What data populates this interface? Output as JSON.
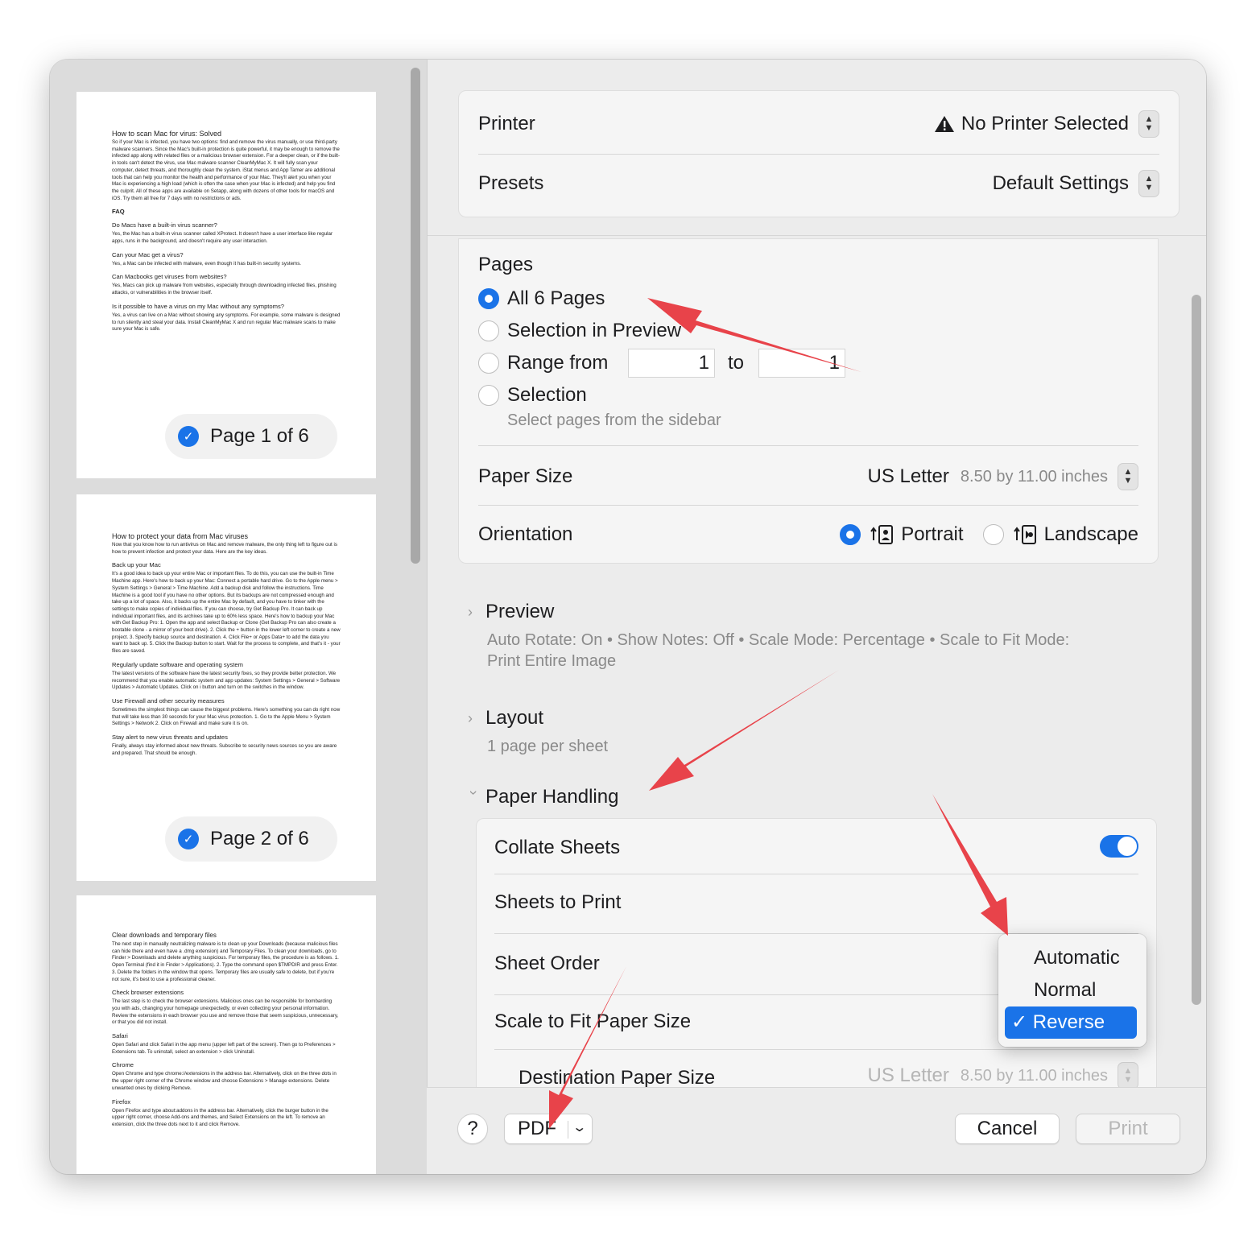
{
  "colors": {
    "accent": "#1a73e8",
    "arrow": "#e8434a"
  },
  "sidebar": {
    "pages": [
      {
        "badge": "Page 1 of 6",
        "title": "How to scan Mac for virus: Solved",
        "intro": "So if your Mac is infected, you have two options: find and remove the virus manually, or use third-party malware scanners. Since the Mac's built-in protection is quite powerful, it may be enough to remove the infected app along with related files or a malicious browser extension. For a deeper clean, or if the built-in tools can't detect the virus, use Mac malware scanner CleanMyMac X. It will fully scan your computer, detect threats, and thoroughly clean the system. iStat menus and App Tamer are additional tools that can help you monitor the health and performance of your Mac. They'll alert you when your Mac is experiencing a high load (which is often the case when your Mac is infected) and help you find the culprit. All of these apps are available on Setapp, along with dozens of other tools for macOS and iOS. Try them all free for 7 days with no restrictions or ads.",
        "faq": "FAQ",
        "q1": "Do Macs have a built-in virus scanner?",
        "a1": "Yes, the Mac has a built-in virus scanner called XProtect. It doesn't have a user interface like regular apps, runs in the background, and doesn't require any user interaction.",
        "q2": "Can your Mac get a virus?",
        "a2": "Yes, a Mac can be infected with malware, even though it has built-in security systems.",
        "q3": "Can Macbooks get viruses from websites?",
        "a3": "Yes, Macs can pick up malware from websites, especially through downloading infected files, phishing attacks, or vulnerabilities in the browser itself.",
        "q4": "Is it possible to have a virus on my Mac without any symptoms?",
        "a4": "Yes, a virus can live on a Mac without showing any symptoms. For example, some malware is designed to run silently and steal your data. Install CleanMyMac X and run regular Mac malware scans to make sure your Mac is safe."
      },
      {
        "badge": "Page 2 of 6",
        "title": "How to protect your data from Mac viruses",
        "intro": "Now that you know how to run antivirus on Mac and remove malware, the only thing left to figure out is how to prevent infection and protect your data. Here are the key ideas.",
        "q1": "Back up your Mac",
        "a1": "It's a good idea to back up your entire Mac or important files. To do this, you can use the built-in Time Machine app. Here's how to back up your Mac: Connect a portable hard drive. Go to the Apple menu > System Settings > General > Time Machine. Add a backup disk and follow the instructions. Time Machine is a good tool if you have no other options. But its backups are not compressed enough and take up a lot of space. Also, it backs up the entire Mac by default, and you have to tinker with the settings to make copies of individual files. If you can choose, try Get Backup Pro. It can back up individual important files, and its archives take up to 60% less space. Here's how to backup your Mac with Get Backup Pro: 1. Open the app and select Backup or Clone (Get Backup Pro can also create a bootable clone - a mirror of your boot drive). 2. Click the + button in the lower left corner to create a new project. 3. Specify backup source and destination. 4. Click File+ or Apps Data+ to add the data you want to back up. 5. Click the Backup button to start. Wait for the process to complete, and that's it - your files are saved.",
        "q2": "Regularly update software and operating system",
        "a2": "The latest versions of the software have the latest security fixes, so they provide better protection. We recommend that you enable automatic system and app updates: System Settings > General > Software Updates > Automatic Updates. Click on i button and turn on the switches in the window.",
        "q3": "Use Firewall and other security measures",
        "a3": "Sometimes the simplest things can cause the biggest problems. Here's something you can do right now that will take less than 30 seconds for your Mac virus protection. 1. Go to the Apple Menu > System Settings > Network 2. Click on Firewall and make sure it is on.",
        "q4": "Stay alert to new virus threats and updates",
        "a4": "Finally, always stay informed about new threats. Subscribe to security news sources so you are aware and prepared. That should be enough."
      },
      {
        "title": "Clear downloads and temporary files",
        "intro": "The next step in manually neutralizing malware is to clean up your Downloads (because malicious files can hide there and even have a .dmg extension) and Temporary Files. To clean your downloads, go to Finder > Downloads and delete anything suspicious. For temporary files, the procedure is as follows. 1. Open Terminal (find it in Finder > Applications). 2. Type the command open $TMPDIR and press Enter. 3. Delete the folders in the window that opens. Temporary files are usually safe to delete, but if you're not sure, it's best to use a professional cleaner.",
        "q1": "Check browser extensions",
        "a1": "The last step is to check the browser extensions. Malicious ones can be responsible for bombarding you with ads, changing your homepage unexpectedly, or even collecting your personal information. Review the extensions in each browser you use and remove those that seem suspicious, unnecessary, or that you did not install.",
        "q2": "Safari",
        "a2": "Open Safari and click Safari in the app menu (upper left part of the screen). Then go to Preferences > Extensions tab. To uninstall, select an extension > click Uninstall.",
        "q3": "Chrome",
        "a3": "Open Chrome and type chrome://extensions in the address bar. Alternatively, click on the three dots in the upper right corner of the Chrome window and choose Extensions > Manage extensions. Delete unwanted ones by clicking Remove.",
        "q4": "Firefox",
        "a4": "Open Firefox and type about:addons in the address bar. Alternatively, click the burger button in the upper right corner, choose Add-ons and themes, and Select Extensions on the left. To remove an extension, click the three dots next to it and click Remove."
      }
    ]
  },
  "printer": {
    "label": "Printer",
    "value": "No Printer Selected",
    "warning_icon": "warning-triangle-icon"
  },
  "presets": {
    "label": "Presets",
    "value": "Default Settings"
  },
  "pages": {
    "label": "Pages",
    "all": "All 6 Pages",
    "selection_preview": "Selection in Preview",
    "range_from": "Range from",
    "range_start": "1",
    "to": "to",
    "range_end": "1",
    "selection": "Selection",
    "selection_hint": "Select pages from the sidebar",
    "selected": "all"
  },
  "paper_size": {
    "label": "Paper Size",
    "value": "US Letter",
    "dims": "8.50 by 11.00 inches"
  },
  "orientation": {
    "label": "Orientation",
    "portrait": "Portrait",
    "landscape": "Landscape",
    "selected": "portrait"
  },
  "preview": {
    "label": "Preview",
    "summary_1": "Auto Rotate: On • Show Notes: Off • Scale Mode: Percentage • Scale to Fit Mode:",
    "summary_2": "Print Entire Image"
  },
  "layout": {
    "label": "Layout",
    "summary": "1 page per sheet"
  },
  "paper_handling": {
    "label": "Paper Handling",
    "collate": "Collate Sheets",
    "collate_on": true,
    "sheets_to_print": "Sheets to Print",
    "sheet_order": "Sheet Order",
    "scale_to_fit": "Scale to Fit Paper Size",
    "scale_to_fit_on": false,
    "destination": "Destination Paper Size",
    "destination_value": "US Letter",
    "destination_dims": "8.50 by 11.00 inches"
  },
  "sheet_order_menu": {
    "options": [
      "Automatic",
      "Normal",
      "Reverse"
    ],
    "selected": "Reverse",
    "checkmark": "✓"
  },
  "footer": {
    "help": "?",
    "pdf": "PDF",
    "cancel": "Cancel",
    "print": "Print"
  }
}
